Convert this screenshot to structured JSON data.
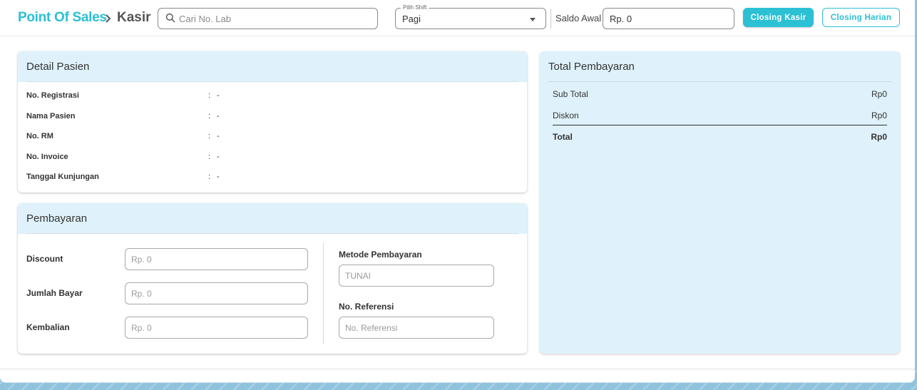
{
  "header": {
    "brand": "Point Of Sales",
    "separator": ">",
    "page": "Kasir",
    "search_placeholder": "Cari No. Lab",
    "shift_label": "Pilih Shift",
    "shift_value": "Pagi",
    "saldo_label": "Saldo Awal",
    "saldo_value": "Rp. 0",
    "closing_kasir": "Closing Kasir",
    "closing_harian": "Closing Harian"
  },
  "detail_pasien": {
    "title": "Detail Pasien",
    "rows": [
      {
        "label": "No. Registrasi",
        "value": "-"
      },
      {
        "label": "Nama Pasien",
        "value": "-"
      },
      {
        "label": "No. RM",
        "value": "-"
      },
      {
        "label": "No. Invoice",
        "value": "-"
      },
      {
        "label": "Tanggal Kunjungan",
        "value": "-"
      }
    ]
  },
  "pembayaran": {
    "title": "Pembayaran",
    "discount_label": "Discount",
    "discount_placeholder": "Rp. 0",
    "jumlah_bayar_label": "Jumlah Bayar",
    "jumlah_bayar_placeholder": "Rp. 0",
    "kembalian_label": "Kembalian",
    "kembalian_placeholder": "Rp. 0",
    "metode_label": "Metode Pembayaran",
    "metode_placeholder": "TUNAI",
    "referensi_label": "No. Referensi",
    "referensi_placeholder": "No. Referensi"
  },
  "total_pembayaran": {
    "title": "Total Pembayaran",
    "sub_total_label": "Sub Total",
    "sub_total_value": "Rp0",
    "diskon_label": "Diskon",
    "diskon_value": "Rp0",
    "total_label": "Total",
    "total_value": "Rp0"
  },
  "colors": {
    "accent": "#2bc0d4",
    "panel_head": "#dff2fb",
    "page_bg": "#8fc3dd"
  }
}
